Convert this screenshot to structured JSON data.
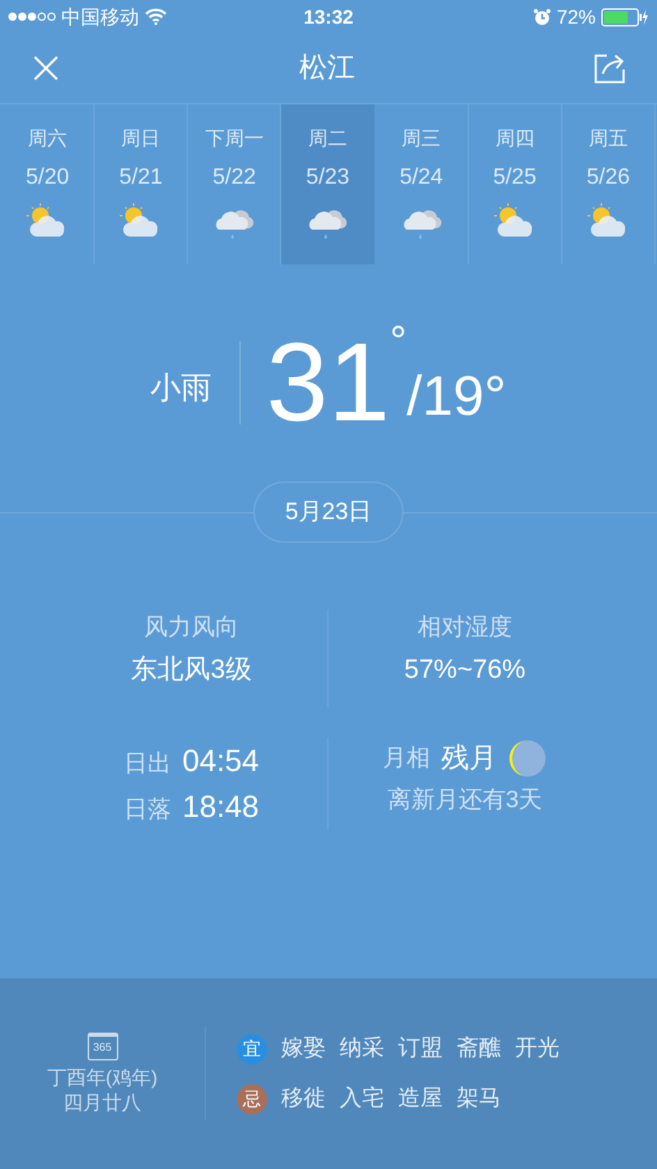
{
  "status_bar": {
    "signal_dots": [
      {
        "filled": true
      },
      {
        "filled": true
      },
      {
        "filled": true
      },
      {
        "filled": false
      },
      {
        "filled": false
      }
    ],
    "carrier": "中国移动",
    "time": "13:32",
    "battery_percent": "72%"
  },
  "header": {
    "title": "松江"
  },
  "days": [
    {
      "weekday": "周六",
      "date": "5/20",
      "kind": "partly_cloudy",
      "selected": false
    },
    {
      "weekday": "周日",
      "date": "5/21",
      "kind": "partly_cloudy",
      "selected": false
    },
    {
      "weekday": "下周一",
      "date": "5/22",
      "kind": "rain",
      "selected": false
    },
    {
      "weekday": "周二",
      "date": "5/23",
      "kind": "rain",
      "selected": true
    },
    {
      "weekday": "周三",
      "date": "5/24",
      "kind": "rain",
      "selected": false
    },
    {
      "weekday": "周四",
      "date": "5/25",
      "kind": "partly_cloudy",
      "selected": false
    },
    {
      "weekday": "周五",
      "date": "5/26",
      "kind": "partly_cloudy",
      "selected": false
    }
  ],
  "today": {
    "condition": "小雨",
    "high": "31",
    "high_unit": "°",
    "separator": "/",
    "low": "19°",
    "date": "5月23日"
  },
  "details": {
    "wind_label": "风力风向",
    "wind_value": "东北风3级",
    "humidity_label": "相对湿度",
    "humidity_value": "57%~76%",
    "sunrise_label": "日出",
    "sunrise": "04:54",
    "sunset_label": "日落",
    "sunset": "18:48",
    "moon_label": "月相",
    "moon_phase": "残月",
    "moon_note": "离新月还有3天"
  },
  "almanac": {
    "icon_text": "365",
    "year": "丁酉年(鸡年)",
    "lunar_date": "四月廿八",
    "rows": [
      {
        "badge": "宜",
        "color": "#2a8ee0",
        "items": [
          "嫁娶",
          "纳采",
          "订盟",
          "斋醮",
          "开光"
        ]
      },
      {
        "badge": "忌",
        "color": "#a8705a",
        "items": [
          "移徙",
          "入宅",
          "造屋",
          "架马"
        ]
      }
    ]
  }
}
